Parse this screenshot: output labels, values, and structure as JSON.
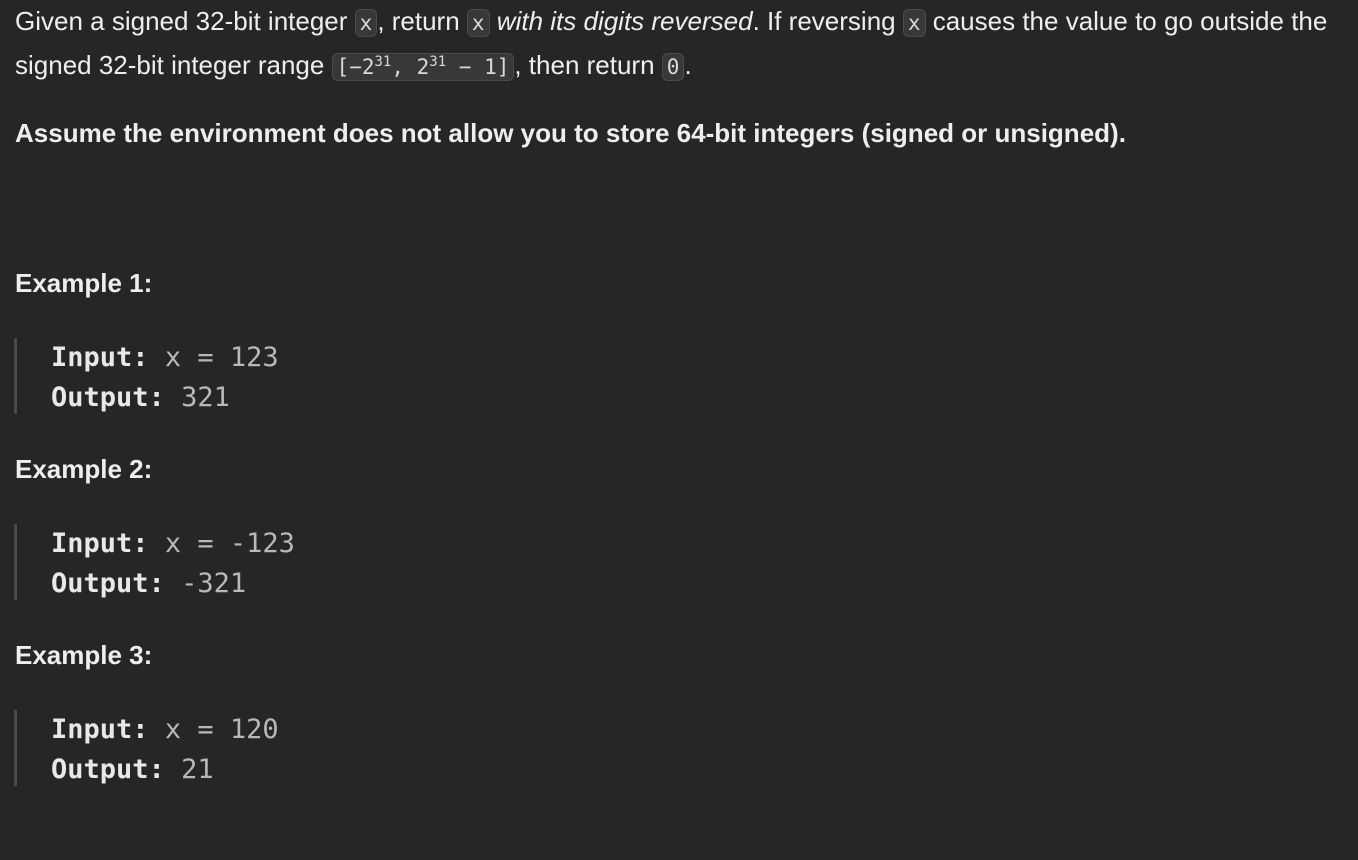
{
  "description": {
    "p1": "Given a signed 32-bit integer ",
    "x1": "x",
    "p2": ", return ",
    "x2": "x",
    "emph": "with its digits reversed",
    "p3": ". If reversing ",
    "x3": "x",
    "p4": " causes the value to go outside the signed 32-bit integer range ",
    "range_open": "[−2",
    "range_exp1": "31",
    "range_mid": ", 2",
    "range_exp2": "31",
    "range_close": " − 1]",
    "p5": ", then return ",
    "zero": "0",
    "p6": "."
  },
  "note": "Assume the environment does not allow you to store 64-bit integers (signed or unsigned).",
  "examples": [
    {
      "title": "Example 1:",
      "input_label": "Input:",
      "input_value": "x = 123",
      "output_label": "Output:",
      "output_value": "321"
    },
    {
      "title": "Example 2:",
      "input_label": "Input:",
      "input_value": "x = -123",
      "output_label": "Output:",
      "output_value": "-321"
    },
    {
      "title": "Example 3:",
      "input_label": "Input:",
      "input_value": "x = 120",
      "output_label": "Output:",
      "output_value": "21"
    }
  ]
}
